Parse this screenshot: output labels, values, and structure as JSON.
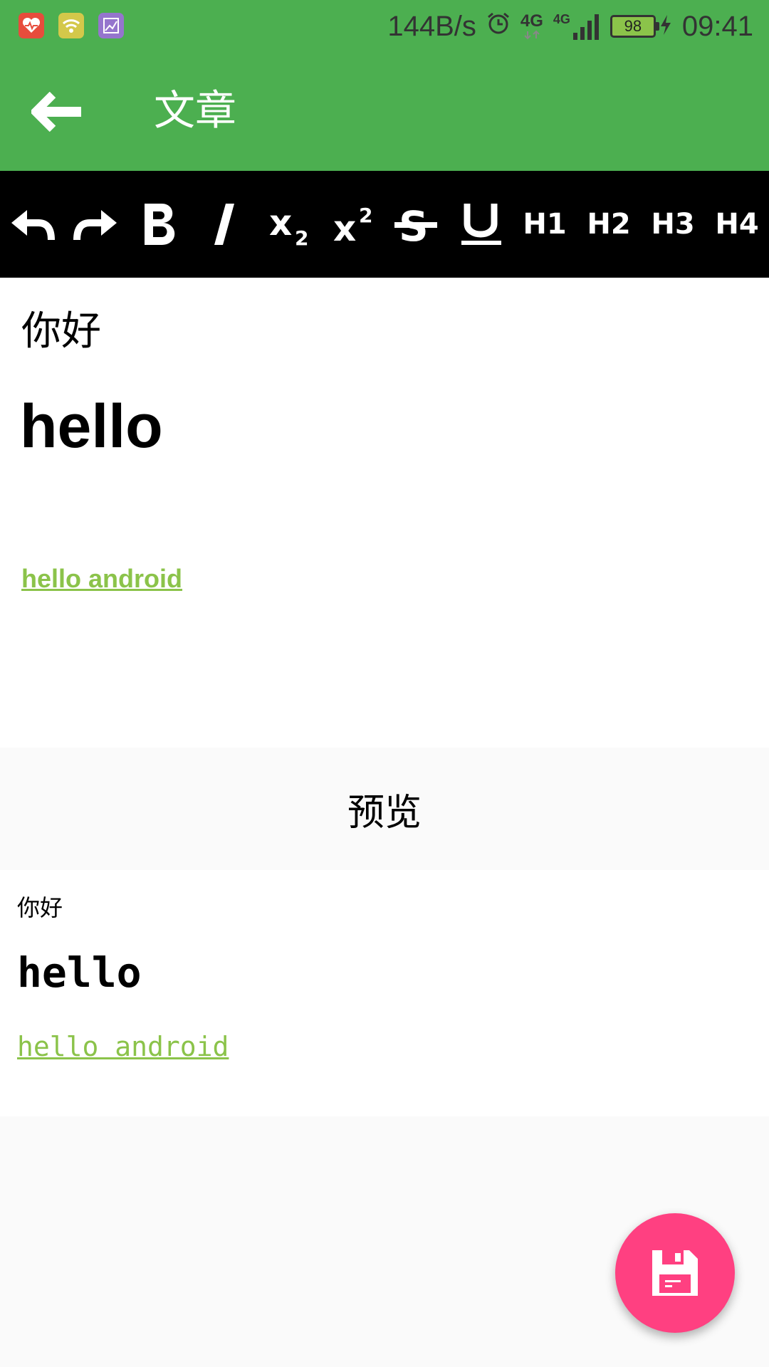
{
  "status_bar": {
    "network_speed": "144B/s",
    "net_type_1": "4G",
    "net_type_2": "4G",
    "battery_level": "98",
    "time": "09:41",
    "icons": [
      "health-icon",
      "wifi-app-icon",
      "gallery-icon",
      "alarm-icon",
      "signal-icon",
      "charging-icon"
    ]
  },
  "app_bar": {
    "title": "文章"
  },
  "toolbar": {
    "h1": "H1",
    "h2": "H2",
    "h3": "H3",
    "h4": "H4",
    "icons": [
      "undo-icon",
      "redo-icon",
      "bold-icon",
      "italic-icon",
      "subscript-icon",
      "superscript-icon",
      "strikethrough-icon",
      "underline-icon"
    ]
  },
  "editor": {
    "paragraph": "你好",
    "heading": "hello",
    "link": "hello android"
  },
  "preview": {
    "title": "预览",
    "paragraph": "你好",
    "heading": "hello",
    "link": "hello android"
  },
  "colors": {
    "primary": "#4caf50",
    "accent": "#ff4081",
    "link": "#8bc34a",
    "toolbar": "#000000"
  }
}
